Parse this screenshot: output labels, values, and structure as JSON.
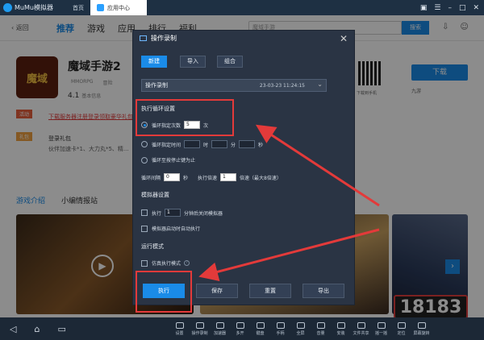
{
  "titlebar": {
    "app": "MuMu模拟器",
    "tabs": [
      "首页",
      "应用中心"
    ]
  },
  "nav": {
    "back": "返回",
    "items": [
      "推荐",
      "游戏",
      "应用",
      "排行",
      "福利"
    ],
    "search_placeholder": "魔域手游",
    "search_btn": "搜索"
  },
  "game": {
    "icon_text": "魔域",
    "title": "魔域手游2",
    "meta": [
      "MMORPG",
      "冒险"
    ],
    "rating": "4.1",
    "rating_label": "基本信息",
    "download": "下载",
    "qr_label": "下载到手机",
    "jiuyou": "九游",
    "badge_hot": "活动",
    "badge_gift": "礼包",
    "hot_text": "下载服务器注册登录领取豪华礼包...",
    "gift_title": "登录礼包",
    "gift_desc": "伙伴加速卡*1、大力丸*5、精..."
  },
  "section_tabs": [
    "游戏介绍",
    "小编情报站"
  ],
  "dialog": {
    "title": "操作录制",
    "top_buttons": [
      "新建",
      "导入",
      "组合"
    ],
    "script_name": "操作录制",
    "script_time": "23-03-23 11:24:15",
    "loop_title": "执行循环设置",
    "loop_count_label": "循环指定次数",
    "loop_count_value": "5",
    "loop_count_unit": "次",
    "loop_time_label": "循环指定时间",
    "time_units": [
      "时",
      "分",
      "秒"
    ],
    "loop_until_stop": "循环至按停止键为止",
    "interval_label": "循环间隔",
    "interval_value": "0",
    "interval_unit": "秒",
    "speed_label": "执行倍速",
    "speed_value": "1",
    "speed_unit": "倍速（最大8倍速）",
    "emu_title": "模拟器设置",
    "emu_exec": "执行",
    "emu_exec_value": "1",
    "emu_exec_after": "分钟后关闭模拟器",
    "emu_autostart": "模拟器启动时自动执行",
    "mode_title": "运行模式",
    "mode_sim": "仿真执行模式",
    "bottom_buttons": [
      "执行",
      "保存",
      "重置",
      "导出"
    ]
  },
  "bottombar": {
    "items": [
      "设置",
      "操作录制",
      "加速器",
      "多开",
      "键盘",
      "手柄",
      "全屏",
      "音量",
      "安装",
      "文件共享",
      "摇一摇",
      "定位",
      "屏幕旋转"
    ]
  },
  "watermark": "18183",
  "colors": {
    "accent": "#1a8be8",
    "highlight": "#e33a3a",
    "dialog_bg": "#2a3444"
  }
}
